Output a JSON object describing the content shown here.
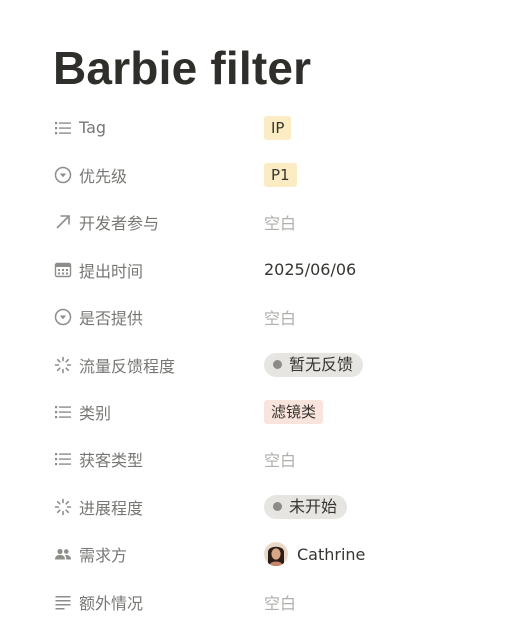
{
  "page": {
    "title": "Barbie filter"
  },
  "properties": [
    {
      "name": "Tag",
      "value": "IP"
    },
    {
      "name": "优先级",
      "value": "P1"
    },
    {
      "name": "开发者参与",
      "value": "空白"
    },
    {
      "name": "提出时间",
      "value": "2025/06/06"
    },
    {
      "name": "是否提供",
      "value": "空白"
    },
    {
      "name": "流量反馈程度",
      "value": "暂无反馈"
    },
    {
      "name": "类别",
      "value": "滤镜类"
    },
    {
      "name": "获客类型",
      "value": "空白"
    },
    {
      "name": "进展程度",
      "value": "未开始"
    },
    {
      "name": "需求方",
      "value": "Cathrine"
    },
    {
      "name": "额外情况",
      "value": "空白"
    }
  ],
  "colors": {
    "tag_yellow": "#fbecc3",
    "tag_pink": "#f8e3dd",
    "status_gray": "#e6e5e2",
    "empty_text": "#b0afab",
    "property_text": "#787774"
  },
  "icons": [
    "list-icon",
    "select-circle-icon",
    "arrow-up-right-icon",
    "calendar-icon",
    "select-circle-icon",
    "status-spinner-icon",
    "list-icon",
    "list-icon",
    "status-spinner-icon",
    "people-icon",
    "text-lines-icon"
  ]
}
